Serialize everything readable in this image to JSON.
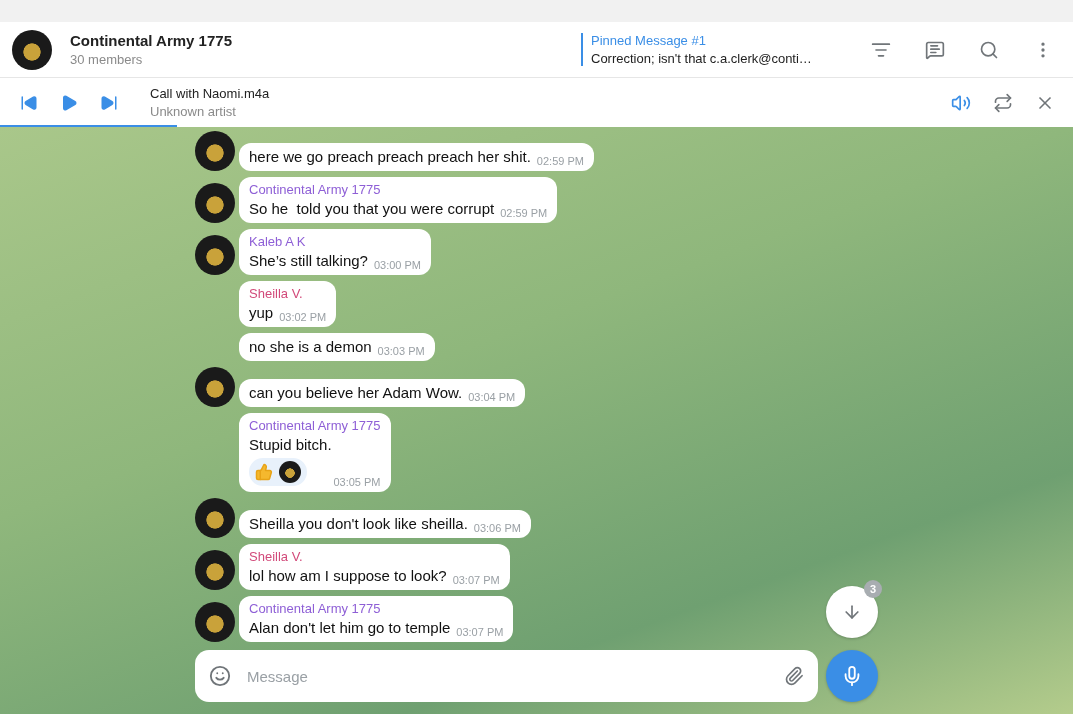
{
  "chat": {
    "title": "Continental Army 1775",
    "subtitle": "30 members"
  },
  "pinned": {
    "label": "Pinned Message #1",
    "text": "Correction; isn't that c.a.clerk@conti…"
  },
  "player": {
    "title": "Call with Naomi.m4a",
    "artist": "Unknown artist",
    "level": 0.165,
    "playing": false
  },
  "messages": [
    {
      "text": "here we go preach preach preach her shit.",
      "time": "02:59 PM",
      "avatar": true,
      "reacted": false
    },
    {
      "sender": "Continental Army 1775",
      "color": "#8e5fd6",
      "text": "So he  told you that you were corrupt",
      "time": "02:59 PM",
      "avatar": true,
      "reacted": false
    },
    {
      "sender": "Kaleb A K",
      "color": "#8e5fd6",
      "text": "She’s still talking?",
      "time": "03:00 PM",
      "avatar": true,
      "reacted": false
    },
    {
      "sender": "Sheilla V.",
      "color": "#d24a7a",
      "text": "yup",
      "time": "03:02 PM",
      "avatar": false,
      "reacted": false
    },
    {
      "text": "no she is a demon",
      "time": "03:03 PM",
      "avatar": false,
      "reacted": false
    },
    {
      "text": "can you believe her Adam Wow.",
      "time": "03:04 PM",
      "avatar": true,
      "reacted": false
    },
    {
      "sender": "Continental Army 1775",
      "color": "#8e5fd6",
      "text": "Stupid bitch.",
      "time": "03:05 PM",
      "avatar": false,
      "reacted": true
    },
    {
      "text": "Sheilla you don't look like sheilla.",
      "time": "03:06 PM",
      "avatar": true,
      "reacted": false
    },
    {
      "sender": "Sheilla V.",
      "color": "#d24a7a",
      "text": "lol how am I suppose to look?",
      "time": "03:07 PM",
      "avatar": true,
      "reacted": false
    },
    {
      "sender": "Continental Army 1775",
      "color": "#8e5fd6",
      "text": "Alan don't let him go to temple",
      "time": "03:07 PM",
      "avatar": true,
      "reacted": false
    }
  ],
  "scroll_badge": "3",
  "composer": {
    "placeholder": "Message"
  }
}
